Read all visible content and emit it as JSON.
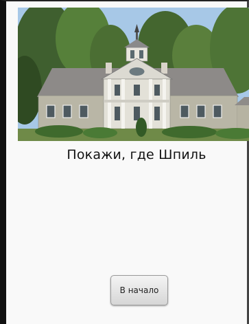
{
  "screen": {
    "prompt_text": "Покажи, где Шпиль",
    "home_button_label": "В начало"
  },
  "photo": {
    "subject": "manor-house"
  }
}
